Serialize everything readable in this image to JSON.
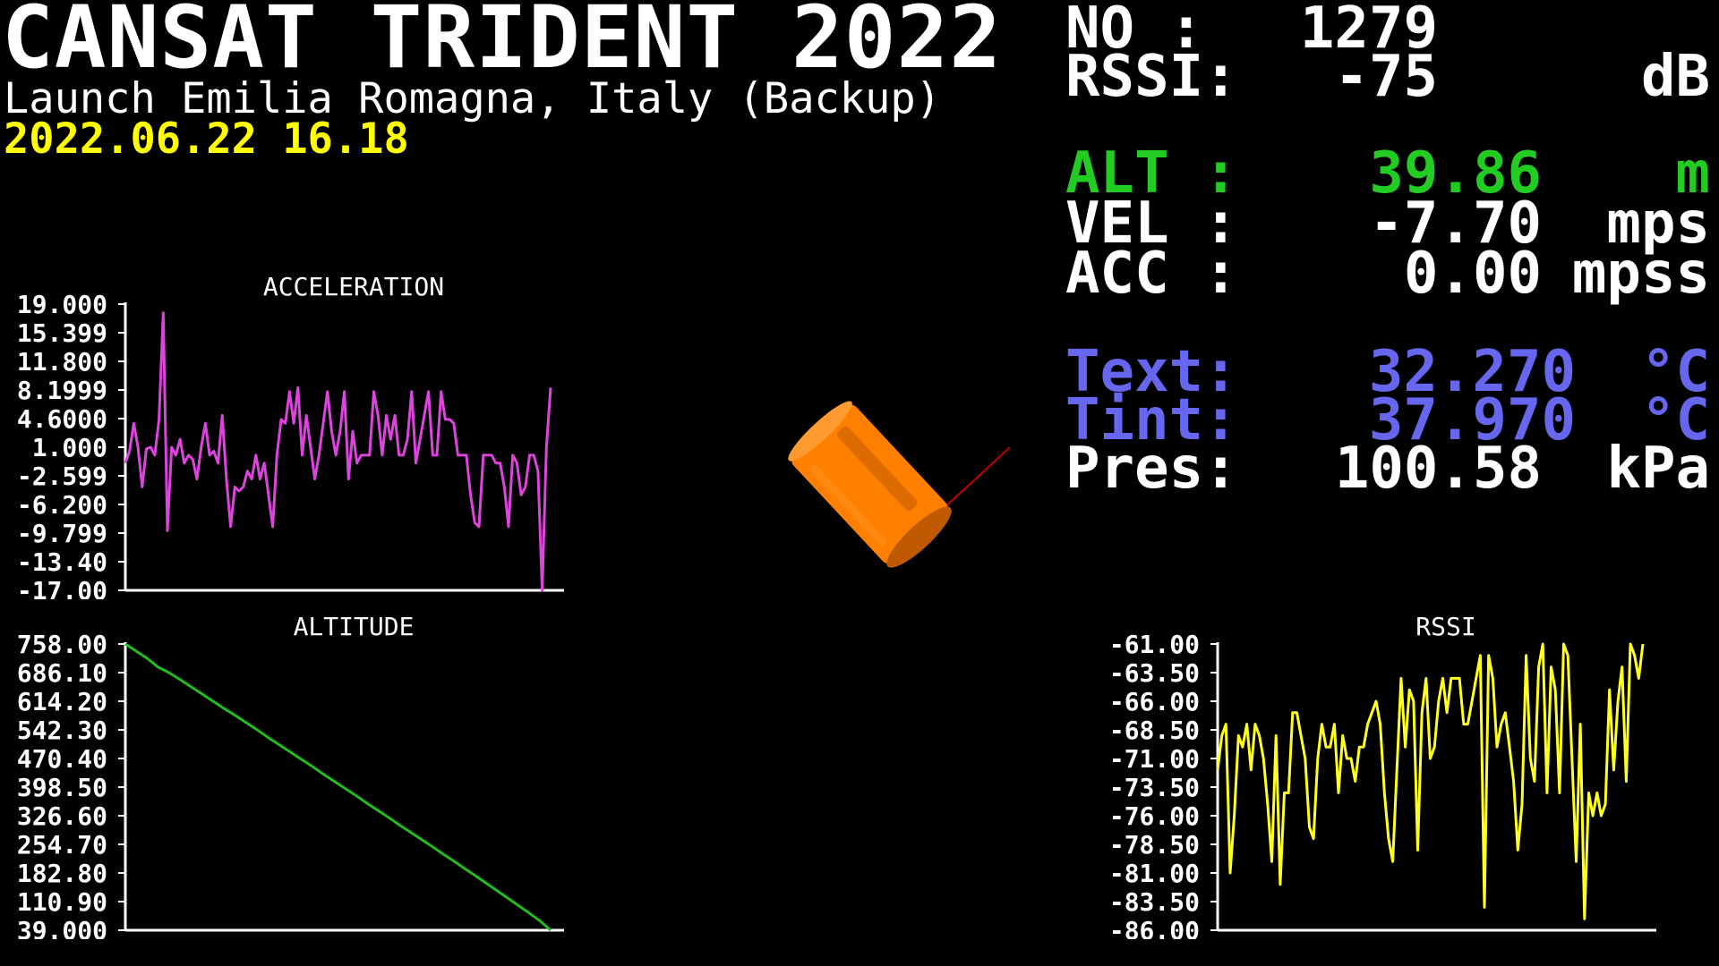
{
  "header": {
    "title": "CANSAT TRIDENT 2022",
    "subtitle": "Launch Emilia Romagna, Italy (Backup)",
    "datetime": "2022.06.22 16.18"
  },
  "telemetry": {
    "no": {
      "label": "NO  :",
      "value": "1279",
      "unit": ""
    },
    "rssi": {
      "label": "RSSI:",
      "value": "-75",
      "unit": "dB"
    },
    "alt": {
      "label": "ALT :",
      "value": "39.86",
      "unit": "m"
    },
    "vel": {
      "label": "VEL :",
      "value": "-7.70",
      "unit": "mps"
    },
    "acc": {
      "label": "ACC :",
      "value": "0.00",
      "unit": "mpss"
    },
    "text": {
      "label": "Text:",
      "value": "32.270",
      "unit": "°C"
    },
    "tint": {
      "label": "Tint:",
      "value": "37.970",
      "unit": "°C"
    },
    "pres": {
      "label": "Pres:",
      "value": "100.58",
      "unit": "kPa"
    }
  },
  "colors": {
    "background": "#000000",
    "text": "#ffffff",
    "datetime": "#ffff00",
    "altitude": "#22cc22",
    "temperature": "#6666ee",
    "acceleration_line": "#dd44dd",
    "altitude_line": "#22bb22",
    "rssi_line": "#ffff22",
    "model": "#ff8000"
  },
  "model_icon": "cansat-3d-model",
  "chart_data": [
    {
      "type": "line",
      "title": "ACCELERATION",
      "ylim": [
        -17.0,
        19.0
      ],
      "yticks": [
        "19.000",
        "15.399",
        "11.800",
        "8.1999",
        "4.6000",
        "1.000",
        "-2.599",
        "-6.200",
        "-9.799",
        "-13.40",
        "-17.00"
      ],
      "series": [
        {
          "values": [
            -1.0,
            0.5,
            4.0,
            1.0,
            -4.0,
            0.8,
            1.0,
            0.0,
            4.5,
            17.9,
            -9.5,
            1.0,
            0.0,
            2.0,
            -1.0,
            0.0,
            -0.5,
            -3.0,
            1.0,
            4.0,
            0.0,
            0.5,
            -1.0,
            5.0,
            -3.0,
            -9.0,
            -4.0,
            -4.5,
            -4.0,
            -2.0,
            -3.0,
            0.0,
            -3.0,
            -1.0,
            -5.0,
            -9.0,
            0.0,
            4.5,
            4.0,
            8.0,
            4.0,
            8.5,
            0.0,
            5.0,
            1.0,
            -3.0,
            0.0,
            4.0,
            8.0,
            3.0,
            0.0,
            3.0,
            8.0,
            -3.0,
            3.0,
            -1.0,
            0.0,
            0.0,
            0.0,
            8.0,
            5.0,
            0.0,
            5.0,
            2.0,
            5.0,
            0.0,
            0.0,
            2.0,
            8.0,
            -1.0,
            2.0,
            5.0,
            8.0,
            0.0,
            0.0,
            8.0,
            4.5,
            4.5,
            4.0,
            0.0,
            0.0,
            0.0,
            -5.0,
            -8.5,
            -9.0,
            0.0,
            0.0,
            0.0,
            -1.0,
            -1.0,
            -4.0,
            -9.0,
            0.0,
            -1.0,
            -5.0,
            -4.0,
            0.0,
            0.0,
            -2.0,
            -17.0,
            1.0,
            8.5
          ]
        }
      ]
    },
    {
      "type": "line",
      "title": "ALTITUDE",
      "ylim": [
        39.0,
        758.0
      ],
      "yticks": [
        "758.00",
        "686.10",
        "614.20",
        "542.30",
        "470.40",
        "398.50",
        "326.60",
        "254.70",
        "182.80",
        "110.90",
        "39.000"
      ],
      "series": [
        {
          "values": [
            758.0,
            740.0,
            722.0,
            700.0,
            686.0,
            669.0,
            651.0,
            633.0,
            615.0,
            597.0,
            580.0,
            562.0,
            544.0,
            525.0,
            507.0,
            489.0,
            471.0,
            453.0,
            434.0,
            416.0,
            398.0,
            380.0,
            361.0,
            343.0,
            325.0,
            306.0,
            288.0,
            270.0,
            252.0,
            233.0,
            215.0,
            196.0,
            178.0,
            159.0,
            140.0,
            121.0,
            102.0,
            83.0,
            63.0,
            39.0
          ]
        }
      ]
    },
    {
      "type": "line",
      "title": "RSSI",
      "ylim": [
        -86.0,
        -61.0
      ],
      "yticks": [
        "-61.00",
        "-63.50",
        "-66.00",
        "-68.50",
        "-71.00",
        "-73.50",
        "-76.00",
        "-78.50",
        "-81.00",
        "-83.50",
        "-86.00"
      ],
      "series": [
        {
          "values": [
            -72.0,
            -69.0,
            -68.0,
            -81.0,
            -76.0,
            -69.0,
            -70.0,
            -68.0,
            -72.0,
            -68.0,
            -69.0,
            -71.0,
            -75.0,
            -80.0,
            -69.0,
            -82.0,
            -74.0,
            -74.0,
            -67.0,
            -67.0,
            -69.0,
            -71.0,
            -77.0,
            -78.0,
            -71.0,
            -68.0,
            -70.0,
            -70.0,
            -68.0,
            -74.0,
            -69.0,
            -71.0,
            -71.0,
            -73.0,
            -70.0,
            -70.0,
            -68.0,
            -67.0,
            -66.0,
            -68.0,
            -74.0,
            -78.0,
            -80.0,
            -72.0,
            -64.0,
            -70.0,
            -65.0,
            -66.0,
            -79.0,
            -67.0,
            -64.0,
            -71.0,
            -70.0,
            -66.0,
            -64.0,
            -67.0,
            -64.0,
            -64.0,
            -64.0,
            -68.0,
            -68.0,
            -66.0,
            -64.0,
            -62.0,
            -84.0,
            -62.0,
            -64.0,
            -70.0,
            -68.0,
            -67.0,
            -70.0,
            -73.0,
            -79.0,
            -75.0,
            -62.0,
            -71.0,
            -73.0,
            -63.0,
            -61.0,
            -74.0,
            -63.0,
            -65.0,
            -74.0,
            -61.0,
            -62.0,
            -71.0,
            -80.0,
            -68.0,
            -85.0,
            -74.0,
            -76.0,
            -74.0,
            -76.0,
            -75.0,
            -65.0,
            -72.0,
            -66.0,
            -63.0,
            -73.0,
            -61.0,
            -62.0,
            -64.0,
            -61.0
          ]
        }
      ]
    }
  ]
}
